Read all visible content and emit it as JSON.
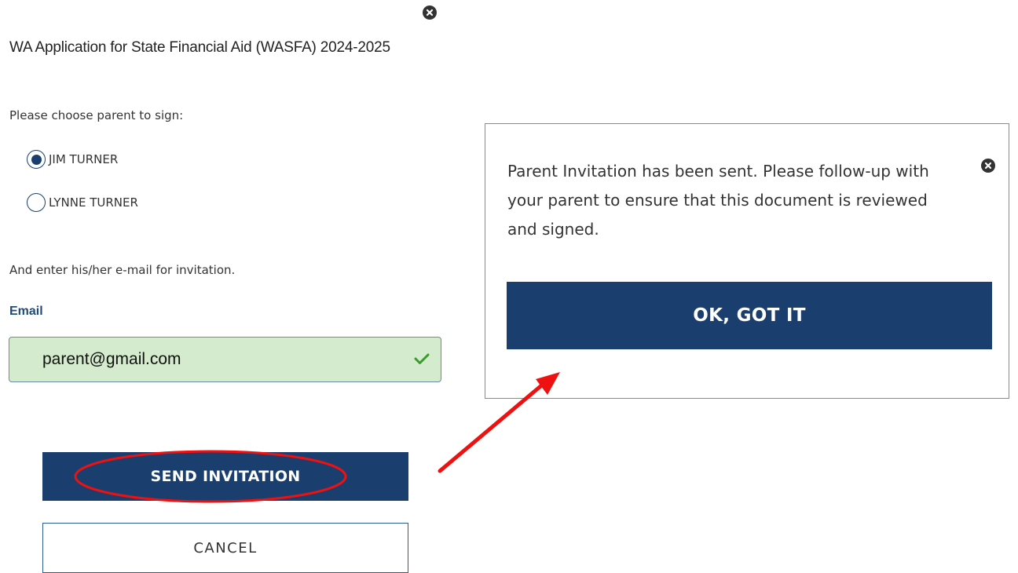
{
  "form": {
    "title": "WA Application for State Financial Aid (WASFA) 2024-2025",
    "choose_prompt": "Please choose parent to sign:",
    "parents": [
      {
        "label": "JIM TURNER",
        "selected": true
      },
      {
        "label": "LYNNE TURNER",
        "selected": false
      }
    ],
    "invite_prompt": "And enter his/her e-mail for invitation.",
    "email_label": "Email",
    "email_value": "parent@gmail.com",
    "send_label": "SEND INVITATION",
    "cancel_label": "CANCEL"
  },
  "popup": {
    "message": "Parent Invitation has been sent. Please follow-up with your parent to ensure that this document is reviewed and signed.",
    "ok_label": "OK, GOT IT"
  },
  "icons": {
    "form_close": "close-icon",
    "popup_close": "close-icon",
    "email_valid": "check-icon"
  },
  "colors": {
    "primary": "#1a3f6f",
    "email_valid_bg": "#d4eccd",
    "check": "#3a9a2a",
    "annotation": "#ee1111"
  }
}
